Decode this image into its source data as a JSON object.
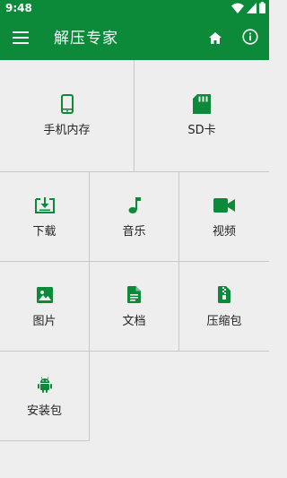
{
  "status_bar": {
    "time": "9:48"
  },
  "app_bar": {
    "title": "解压专家",
    "menu_icon": "menu-icon",
    "home_icon": "home-icon",
    "info_icon": "info-icon"
  },
  "colors": {
    "primary": "#0c8a3a",
    "background": "#eeeeee",
    "divider": "#c8c8c8",
    "text": "#222222"
  },
  "categories": [
    {
      "label": "手机内存",
      "icon": "phone-icon"
    },
    {
      "label": "SD卡",
      "icon": "sd-card-icon"
    },
    {
      "label": "下载",
      "icon": "download-icon"
    },
    {
      "label": "音乐",
      "icon": "music-note-icon"
    },
    {
      "label": "视频",
      "icon": "video-camera-icon"
    },
    {
      "label": "图片",
      "icon": "image-icon"
    },
    {
      "label": "文档",
      "icon": "document-icon"
    },
    {
      "label": "压缩包",
      "icon": "zip-archive-icon"
    },
    {
      "label": "安装包",
      "icon": "android-icon"
    }
  ]
}
